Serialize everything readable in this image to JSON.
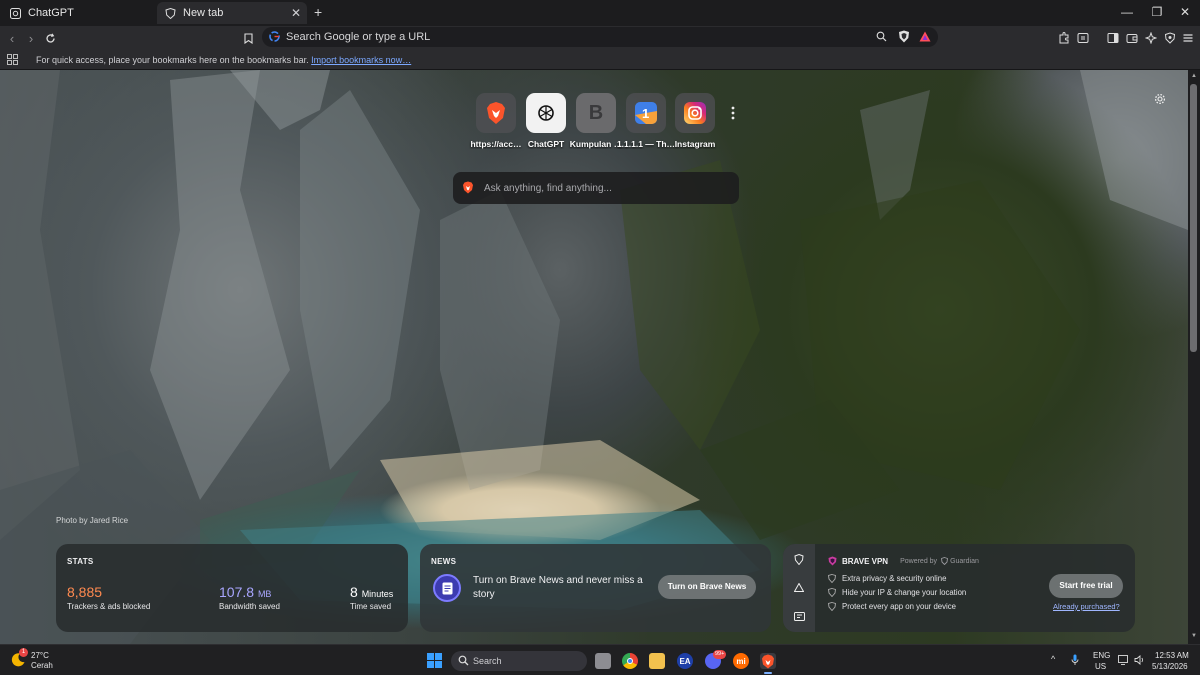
{
  "tabs": [
    {
      "label": "ChatGPT",
      "icon": "chatgpt-icon",
      "active": false
    },
    {
      "label": "New tab",
      "icon": "brave-shield-icon",
      "active": true
    }
  ],
  "window": {
    "minimize": "—",
    "restore": "❐",
    "close": "✕"
  },
  "omnibox": {
    "placeholder": "Search Google or type a URL"
  },
  "bookmarks_bar": {
    "message": "For quick access, place your bookmarks here on the bookmarks bar.",
    "link": "Import bookmarks now…"
  },
  "top_sites": [
    {
      "label": "https://acc…",
      "icon": "brave-lion-icon",
      "color": "#fb542b"
    },
    {
      "label": "ChatGPT",
      "icon": "chatgpt-icon",
      "color": "#ffffff"
    },
    {
      "label": "Kumpulan …",
      "icon": "letter-b-icon",
      "color": "#5a5a5a"
    },
    {
      "label": "1.1.1.1 — Th…",
      "icon": "cloudflare-one-icon",
      "color": "#4b8ef0"
    },
    {
      "label": "Instagram",
      "icon": "instagram-icon",
      "color": "#e1306c"
    }
  ],
  "search": {
    "placeholder": "Ask anything, find anything..."
  },
  "photo_credit": "Photo by Jared Rice",
  "stats": {
    "title": "STATS",
    "trackers_value": "8,885",
    "trackers_label": "Trackers & ads blocked",
    "bandwidth_value": "107.8",
    "bandwidth_unit": "MB",
    "bandwidth_label": "Bandwidth saved",
    "time_value": "8",
    "time_unit": "Minutes",
    "time_label": "Time saved"
  },
  "news": {
    "title": "NEWS",
    "message": "Turn on Brave News and never miss a story",
    "button": "Turn on Brave News"
  },
  "vpn": {
    "title": "BRAVE VPN",
    "powered": "Powered by",
    "partner": "Guardian",
    "features": [
      "Extra privacy & security online",
      "Hide your IP & change your location",
      "Protect every app on your device"
    ],
    "cta": "Start free trial",
    "link": "Already purchased?"
  },
  "taskbar": {
    "weather_temp": "27°C",
    "weather_desc": "Cerah",
    "search_label": "Search",
    "lang": "ENG",
    "region": "US",
    "time": "12:53 AM",
    "date": "5/13/2026",
    "weather_badge": "1",
    "discord_badge": "99+"
  },
  "colors": {
    "accent": "#fb542b",
    "tracker_orange": "#ff8a50",
    "bandwidth_purple": "#a9a6ff",
    "link_blue": "#7ba8ff"
  }
}
